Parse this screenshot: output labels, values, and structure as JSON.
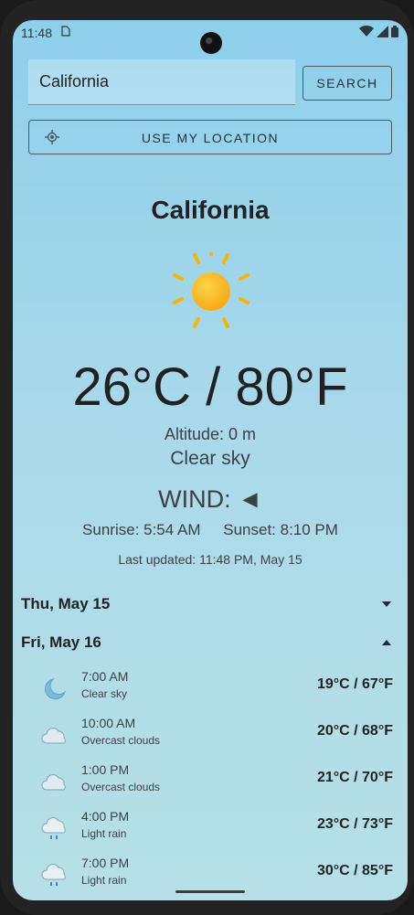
{
  "status_bar": {
    "time": "11:48",
    "sim_icon": "sim-card-icon",
    "icons": [
      "wifi-icon",
      "signal-icon",
      "battery-icon"
    ]
  },
  "search": {
    "value": "California",
    "placeholder": "",
    "button_label": "SEARCH"
  },
  "location_button": {
    "label": "USE MY LOCATION",
    "icon": "my-location-icon"
  },
  "current": {
    "city": "California",
    "icon": "sun-icon",
    "temperature": "26°C / 80°F",
    "altitude": "Altitude: 0 m",
    "condition": "Clear sky",
    "wind": "WIND: ◄",
    "sunrise": "Sunrise: 5:54 AM",
    "sunset": "Sunset: 8:10 PM",
    "last_updated": "Last updated: 11:48 PM, May 15"
  },
  "forecast": [
    {
      "day": "Thu, May 15",
      "expanded": false
    },
    {
      "day": "Fri, May 16",
      "expanded": true,
      "hours": [
        {
          "time": "7:00 AM",
          "desc": "Clear sky",
          "temp": "19°C / 67°F",
          "icon": "moon-icon"
        },
        {
          "time": "10:00 AM",
          "desc": "Overcast clouds",
          "temp": "20°C / 68°F",
          "icon": "cloud-icon"
        },
        {
          "time": "1:00 PM",
          "desc": "Overcast clouds",
          "temp": "21°C / 70°F",
          "icon": "cloud-icon"
        },
        {
          "time": "4:00 PM",
          "desc": "Light rain",
          "temp": "23°C / 73°F",
          "icon": "rain-cloud-icon"
        },
        {
          "time": "7:00 PM",
          "desc": "Light rain",
          "temp": "30°C / 85°F",
          "icon": "rain-cloud-icon"
        }
      ]
    }
  ],
  "colors": {
    "sky_top": "#8ecfea",
    "sky_bottom": "#b6e0e6",
    "sun": "#f9b820",
    "sun_rays": "#f5b400"
  }
}
